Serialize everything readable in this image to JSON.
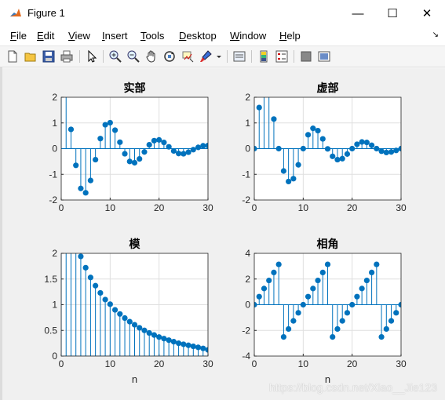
{
  "window": {
    "title": "Figure 1",
    "minimize_glyph": "—",
    "maximize_glyph": "☐",
    "close_glyph": "✕"
  },
  "menu": {
    "items": [
      {
        "label": "File",
        "key": "F",
        "rest": "ile"
      },
      {
        "label": "Edit",
        "key": "E",
        "rest": "dit"
      },
      {
        "label": "View",
        "key": "V",
        "rest": "iew"
      },
      {
        "label": "Insert",
        "key": "I",
        "rest": "nsert"
      },
      {
        "label": "Tools",
        "key": "T",
        "rest": "ools"
      },
      {
        "label": "Desktop",
        "key": "D",
        "rest": "esktop"
      },
      {
        "label": "Window",
        "key": "W",
        "rest": "indow"
      },
      {
        "label": "Help",
        "key": "H",
        "rest": "elp"
      }
    ],
    "dock_arrow": "↘"
  },
  "toolbar": {
    "icons": [
      "new-figure-icon",
      "open-file-icon",
      "save-icon",
      "print-icon",
      "edit-plot-icon",
      "zoom-in-icon",
      "zoom-out-icon",
      "pan-icon",
      "rotate-3d-icon",
      "data-cursor-icon",
      "brush-icon",
      "link-plot-icon",
      "insert-colorbar-icon",
      "insert-legend-icon",
      "hide-plot-tools-icon",
      "show-plot-tools-icon"
    ]
  },
  "watermark": "https://blog.csdn.net/Xiao__Jie123",
  "colors": {
    "stem": "#0072bd",
    "axes_bg": "#ffffff",
    "figure_bg": "#f0f0f0",
    "grid": "#dfdfdf"
  },
  "chart_data": [
    {
      "type": "stem",
      "title": "实部",
      "xlabel": "",
      "xlim": [
        0,
        30
      ],
      "ylim": [
        -2,
        2
      ],
      "xticks": [
        "0",
        "10",
        "20",
        "30"
      ],
      "yticks": [
        "-2",
        "-1",
        "0",
        "1",
        "2"
      ],
      "grid": true,
      "x": [
        0,
        1,
        2,
        3,
        4,
        5,
        6,
        7,
        8,
        9,
        10,
        11,
        12,
        13,
        14,
        15,
        16,
        17,
        18,
        19,
        20,
        21,
        22,
        23,
        24,
        25,
        26,
        27,
        28,
        29,
        30
      ],
      "y": [
        3.0,
        2.23,
        0.75,
        -0.65,
        -1.55,
        -1.72,
        -1.24,
        -0.43,
        0.39,
        0.93,
        1.01,
        0.72,
        0.25,
        -0.2,
        -0.5,
        -0.55,
        -0.4,
        -0.13,
        0.15,
        0.31,
        0.34,
        0.24,
        0.07,
        -0.09,
        -0.19,
        -0.2,
        -0.14,
        -0.04,
        0.05,
        0.11,
        0.12
      ]
    },
    {
      "type": "stem",
      "title": "虚部",
      "xlabel": "",
      "xlim": [
        0,
        30
      ],
      "ylim": [
        -2,
        2
      ],
      "xticks": [
        "0",
        "10",
        "20",
        "30"
      ],
      "yticks": [
        "-2",
        "-1",
        "0",
        "1",
        "2"
      ],
      "grid": true,
      "x": [
        0,
        1,
        2,
        3,
        4,
        5,
        6,
        7,
        8,
        9,
        10,
        11,
        12,
        13,
        14,
        15,
        16,
        17,
        18,
        19,
        20,
        21,
        22,
        23,
        24,
        25,
        26,
        27,
        28,
        29,
        30
      ],
      "y": [
        0.0,
        1.6,
        2.37,
        2.28,
        1.15,
        0.0,
        -0.87,
        -1.28,
        -1.17,
        -0.63,
        0.0,
        0.54,
        0.79,
        0.7,
        0.38,
        -0.01,
        -0.3,
        -0.43,
        -0.39,
        -0.21,
        0.0,
        0.17,
        0.26,
        0.24,
        0.13,
        0.0,
        -0.1,
        -0.15,
        -0.13,
        -0.07,
        0.0
      ]
    },
    {
      "type": "stem",
      "title": "模",
      "xlabel": "n",
      "xlim": [
        0,
        30
      ],
      "ylim": [
        0,
        2
      ],
      "xticks": [
        "0",
        "10",
        "20",
        "30"
      ],
      "yticks": [
        "0",
        "0.5",
        "1",
        "1.5",
        "2"
      ],
      "grid": true,
      "x": [
        0,
        1,
        2,
        3,
        4,
        5,
        6,
        7,
        8,
        9,
        10,
        11,
        12,
        13,
        14,
        15,
        16,
        17,
        18,
        19,
        20,
        21,
        22,
        23,
        24,
        25,
        26,
        27,
        28,
        29,
        30
      ],
      "y": [
        3.0,
        2.74,
        2.49,
        2.27,
        1.94,
        1.72,
        1.53,
        1.37,
        1.23,
        1.1,
        1.01,
        0.9,
        0.82,
        0.74,
        0.67,
        0.61,
        0.55,
        0.5,
        0.45,
        0.41,
        0.37,
        0.34,
        0.31,
        0.28,
        0.25,
        0.23,
        0.21,
        0.19,
        0.17,
        0.15,
        0.12
      ]
    },
    {
      "type": "stem",
      "title": "相角",
      "xlabel": "n",
      "xlim": [
        0,
        30
      ],
      "ylim": [
        -4,
        4
      ],
      "xticks": [
        "0",
        "10",
        "20",
        "30"
      ],
      "yticks": [
        "-4",
        "-2",
        "0",
        "2",
        "4"
      ],
      "grid": true,
      "x": [
        0,
        1,
        2,
        3,
        4,
        5,
        6,
        7,
        8,
        9,
        10,
        11,
        12,
        13,
        14,
        15,
        16,
        17,
        18,
        19,
        20,
        21,
        22,
        23,
        24,
        25,
        26,
        27,
        28,
        29,
        30
      ],
      "y": [
        0.0,
        0.63,
        1.26,
        1.89,
        2.51,
        3.14,
        -2.51,
        -1.89,
        -1.26,
        -0.63,
        0.0,
        0.63,
        1.26,
        1.89,
        2.51,
        3.14,
        -2.51,
        -1.89,
        -1.26,
        -0.63,
        0.0,
        0.63,
        1.26,
        1.89,
        2.51,
        3.14,
        -2.51,
        -1.89,
        -1.26,
        -0.63,
        0.0
      ]
    }
  ]
}
